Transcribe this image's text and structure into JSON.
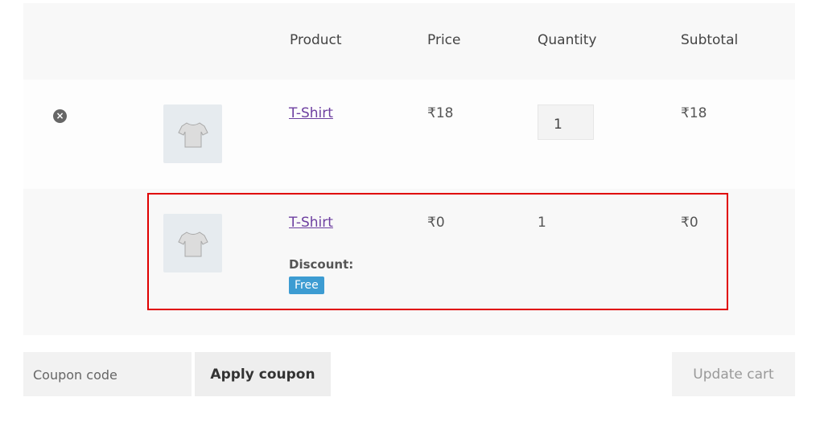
{
  "table": {
    "headers": [
      "Product",
      "Price",
      "Quantity",
      "Subtotal"
    ],
    "rows": [
      {
        "remove_icon": "×",
        "product": "T-Shirt",
        "price": "₹18",
        "quantity": "1",
        "subtotal": "₹18"
      },
      {
        "product": "T-Shirt",
        "price": "₹0",
        "quantity": "1",
        "subtotal": "₹0",
        "discount_label": "Discount:",
        "discount_badge": "Free"
      }
    ]
  },
  "actions": {
    "coupon_placeholder": "Coupon code",
    "apply_label": "Apply coupon",
    "update_label": "Update cart"
  },
  "colors": {
    "link": "#6d3fa0",
    "badge": "#3d9cd2",
    "highlight": "#e00000"
  }
}
